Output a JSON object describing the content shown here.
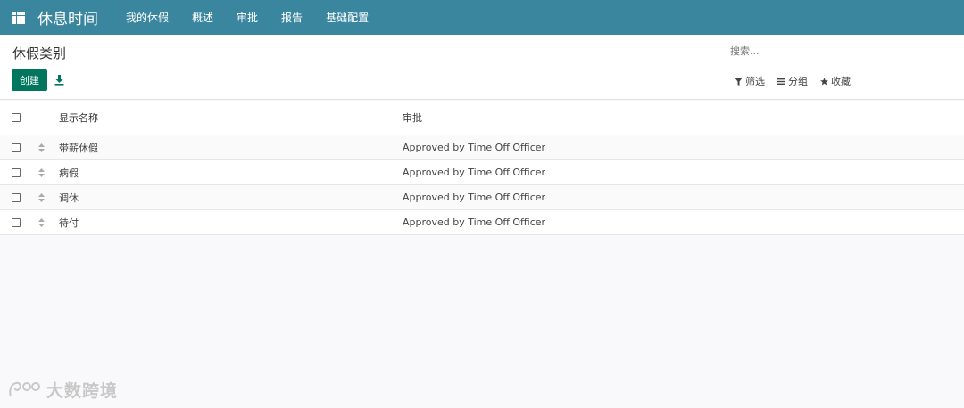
{
  "app": {
    "title": "休息时间",
    "nav": [
      "我的休假",
      "概述",
      "审批",
      "报告",
      "基础配置"
    ]
  },
  "control_panel": {
    "breadcrumb": "休假类别",
    "search_placeholder": "搜索...",
    "create_label": "创建",
    "filters": {
      "filter_label": "筛选",
      "group_label": "分组",
      "favorites_label": "收藏"
    }
  },
  "list": {
    "columns": {
      "name": "显示名称",
      "approval": "审批"
    },
    "rows": [
      {
        "name": "带薪休假",
        "approval": "Approved by Time Off Officer"
      },
      {
        "name": "病假",
        "approval": "Approved by Time Off Officer"
      },
      {
        "name": "调休",
        "approval": "Approved by Time Off Officer"
      },
      {
        "name": "待付",
        "approval": "Approved by Time Off Officer"
      }
    ]
  },
  "watermark": "大数跨境",
  "colors": {
    "topbar": "#3a869f",
    "primary_button": "#00765f",
    "page_background": "#f9f9fb"
  }
}
